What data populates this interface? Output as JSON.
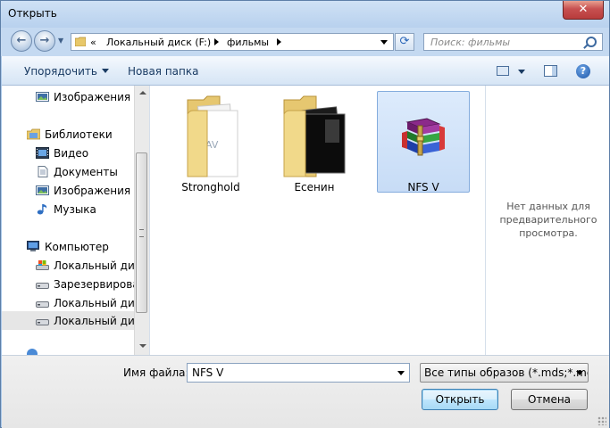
{
  "window": {
    "title": "Открыть",
    "close_label": "✕"
  },
  "address": {
    "overflow": "«",
    "crumbs": [
      "Локальный диск (F:)",
      "фильмы"
    ]
  },
  "search": {
    "placeholder": "Поиск: фильмы"
  },
  "toolbar": {
    "organize_label": "Упорядочить",
    "new_folder_label": "Новая папка",
    "help_label": "?"
  },
  "navpane": {
    "items": [
      {
        "label": "Изображения",
        "icon": "pictures-icon",
        "level": 1
      },
      {
        "label": "Библиотеки",
        "icon": "libraries-icon",
        "level": 0
      },
      {
        "label": "Видео",
        "icon": "video-icon",
        "level": 1
      },
      {
        "label": "Документы",
        "icon": "documents-icon",
        "level": 1
      },
      {
        "label": "Изображения",
        "icon": "pictures-icon",
        "level": 1
      },
      {
        "label": "Музыка",
        "icon": "music-icon",
        "level": 1
      },
      {
        "label": "Компьютер",
        "icon": "computer-icon",
        "level": 0
      },
      {
        "label": "Локальный диск",
        "icon": "system-drive-icon",
        "level": 1
      },
      {
        "label": "Зарезервирован",
        "icon": "drive-icon",
        "level": 1
      },
      {
        "label": "Локальный диск",
        "icon": "drive-icon",
        "level": 1
      },
      {
        "label": "Локальный диск",
        "icon": "drive-icon",
        "level": 1,
        "selected": true
      }
    ]
  },
  "files": [
    {
      "name": "Stronghold",
      "icon": "folder-icon"
    },
    {
      "name": "Есенин",
      "icon": "folder-icon"
    },
    {
      "name": "NFS V",
      "icon": "winrar-archive-icon",
      "selected": true
    }
  ],
  "preview": {
    "text": "Нет данных для предварительного просмотра."
  },
  "bottom": {
    "filename_label": "Имя файла:",
    "filename_value": "NFS V",
    "filetype_value": "Все типы образов (*.mds;*.md",
    "open_label": "Открыть",
    "cancel_label": "Отмена"
  },
  "colors": {
    "accent": "#3c7fb1",
    "selection": "#c7dcf6",
    "frame": "#a9c7e8"
  }
}
